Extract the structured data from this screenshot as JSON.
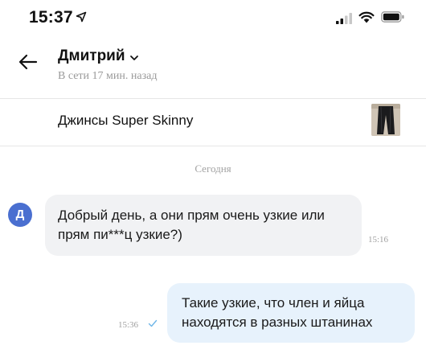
{
  "status_bar": {
    "time": "15:37"
  },
  "header": {
    "contact_name": "Дмитрий",
    "contact_status": "В сети 17 мин. назад"
  },
  "product": {
    "title": "Джинсы Super Skinny"
  },
  "chat": {
    "date_separator": "Сегодня",
    "avatar_letter": "Д",
    "messages": [
      {
        "direction": "incoming",
        "text": "Добрый день, а они прям очень узкие или прям пи***ц узкие?)",
        "time": "15:16"
      },
      {
        "direction": "outgoing",
        "text": "Такие узкие, что член и яйца находятся в разных штанинах",
        "time": "15:36",
        "read_icon": "check-icon"
      }
    ]
  },
  "colors": {
    "avatar": "#4a6fd0",
    "incoming_bubble": "#f1f2f4",
    "outgoing_bubble": "#e7f2fc",
    "check_mark": "#6fb6e8",
    "secondary_text": "#9a9a9a"
  }
}
